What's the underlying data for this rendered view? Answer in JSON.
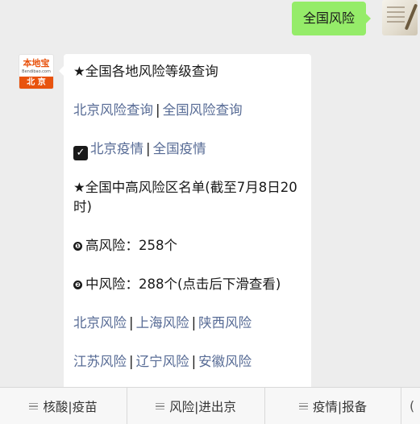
{
  "outgoing": {
    "text": "全国风险"
  },
  "bot": {
    "brand": "本地宝",
    "site": "Bendibao.com",
    "city": "北 京"
  },
  "message": {
    "title": "★全国各地风险等级查询",
    "links1": [
      "北京风险查询",
      "全国风险查询"
    ],
    "links2": [
      "北京疫情",
      "全国疫情"
    ],
    "check_icon": "✓",
    "list_title": "★全国中高风险区名单(截至7月8日20时)",
    "high_marker": "❶",
    "high": "高风险：258个",
    "mid_marker": "❷",
    "mid": "中风险：288个(点击后下滑查看)",
    "region_links1": [
      "北京风险",
      "上海风险",
      "陕西风险"
    ],
    "region_links2": [
      "江苏风险",
      "辽宁风险",
      "安徽风险"
    ],
    "separator": "|"
  },
  "menu": {
    "items": [
      "核酸|疫苗",
      "风险|进出京",
      "疫情|报备"
    ],
    "keyboard_glyph": "("
  }
}
